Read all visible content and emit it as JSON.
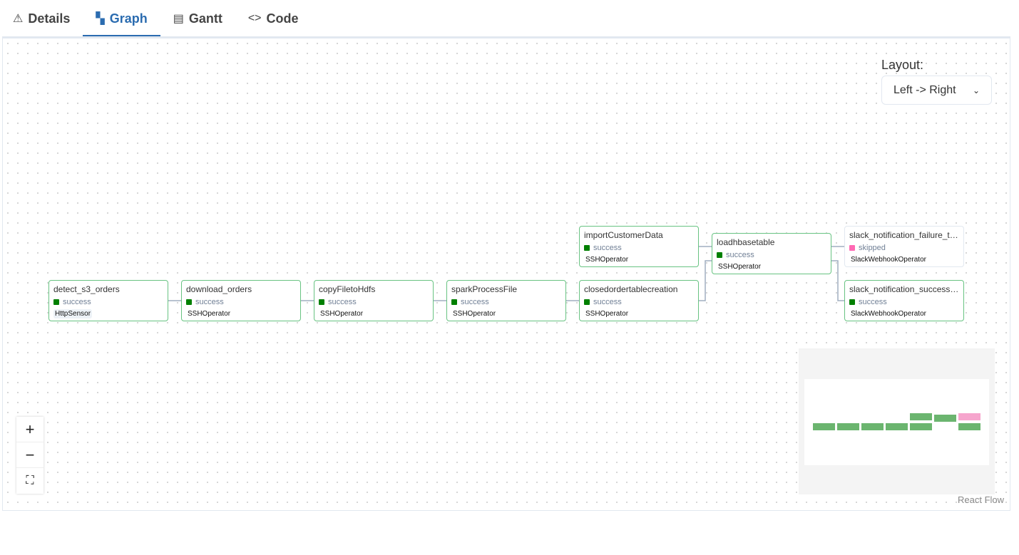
{
  "tabs": [
    {
      "label": "Details",
      "icon": "warning-triangle-icon"
    },
    {
      "label": "Graph",
      "icon": "graph-icon",
      "active": true
    },
    {
      "label": "Gantt",
      "icon": "gantt-icon"
    },
    {
      "label": "Code",
      "icon": "code-icon"
    }
  ],
  "layout": {
    "label": "Layout:",
    "value": "Left -> Right"
  },
  "colors": {
    "success": "#008000",
    "skipped": "#ff69b4",
    "accent": "#2b6cb0"
  },
  "nodes": [
    {
      "name": "detect_s3_orders",
      "state": "success",
      "operator": "HttpSensor"
    },
    {
      "name": "download_orders",
      "state": "success",
      "operator": "SSHOperator"
    },
    {
      "name": "copyFiletoHdfs",
      "state": "success",
      "operator": "SSHOperator"
    },
    {
      "name": "sparkProcessFile",
      "state": "success",
      "operator": "SSHOperator"
    },
    {
      "name": "closedordertablecreation",
      "state": "success",
      "operator": "SSHOperator"
    },
    {
      "name": "importCustomerData",
      "state": "success",
      "operator": "SSHOperator"
    },
    {
      "name": "loadhbasetable",
      "state": "success",
      "operator": "SSHOperator"
    },
    {
      "name": "slack_notification_failure_task",
      "state": "skipped",
      "operator": "SlackWebhookOperator"
    },
    {
      "name": "slack_notification_success_...",
      "state": "success",
      "operator": "SlackWebhookOperator"
    }
  ],
  "controls": {
    "zoom_in": "+",
    "zoom_out": "−",
    "fit": "⛶"
  },
  "attribution": "React Flow"
}
